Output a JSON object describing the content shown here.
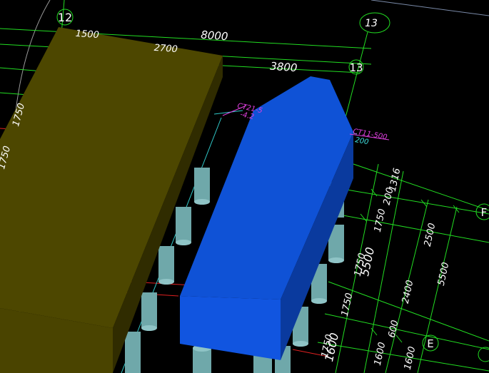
{
  "grid_axes": {
    "axis_12": "12",
    "axis_13_circle": "13",
    "axis_13": "13",
    "axis_f": "F",
    "axis_e": "E"
  },
  "dimensions": {
    "top_8000": "8000",
    "top_3800": "3800",
    "top_1500": "1500",
    "top_2700": "2700",
    "left_1750_a": "1750",
    "left_1750_b": "1750",
    "right_1316": "1316",
    "right_200": "200",
    "right_1750_a": "1750",
    "right_2500": "2500",
    "right_5500_a": "5500",
    "right_1750_b": "1750",
    "right_5500_b": "5500",
    "right_2400": "2400",
    "right_1750_c": "1750",
    "right_600": "600",
    "right_1750_d": "1750",
    "right_1600_a": "1600",
    "right_1600_b": "1600",
    "right_1600_c": "1600"
  },
  "annotations": {
    "ct_left_label": "CT21-5",
    "ct_left_elev": "-4.2",
    "ct_right_label": "CT11-500",
    "ct_right_elev": "200"
  },
  "colors": {
    "background": "#000000",
    "grid_green": "#22dd22",
    "red_axis": "#e02020",
    "cyan_line": "#30c8c8",
    "blue_cap_top": "#0f52d6",
    "blue_cap_side": "#0a3a9e",
    "olive_cap_top": "#4d4700",
    "olive_cap_side": "#302c00",
    "pile": "#6fa8aa"
  }
}
